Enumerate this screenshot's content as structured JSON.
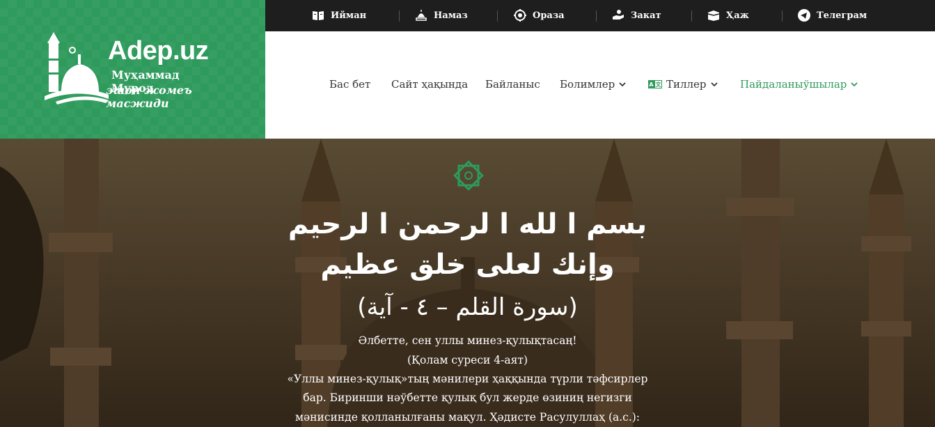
{
  "logo": {
    "title": "Adep.uz",
    "subtitle_line1": "Муҳаммад Мурод",
    "subtitle_line2": "эшон жомеъ масжиди",
    "bg_color": "#2e9a5c"
  },
  "topbar": {
    "items": [
      {
        "label": "Ийман",
        "icon": "quran-icon"
      },
      {
        "label": "Намаз",
        "icon": "prayer-icon"
      },
      {
        "label": "Ораза",
        "icon": "fasting-icon"
      },
      {
        "label": "Закат",
        "icon": "charity-hand-icon"
      },
      {
        "label": "Ҳаж",
        "icon": "kaaba-icon"
      },
      {
        "label": "Телеграм",
        "icon": "telegram-icon"
      }
    ]
  },
  "nav": {
    "items": [
      {
        "label": "Бас бет",
        "dropdown": false
      },
      {
        "label": "Сайт ҳақында",
        "dropdown": false
      },
      {
        "label": "Байланыс",
        "dropdown": false
      },
      {
        "label": "Болимлер",
        "dropdown": true
      },
      {
        "label": "Тиллер",
        "dropdown": true,
        "icon": "translate-icon"
      },
      {
        "label": "Пайдаланыўшылар",
        "dropdown": true,
        "active": true
      }
    ],
    "active_color": "#2e9a5c"
  },
  "hero": {
    "arabic_line1": "بسم ا لله ا لرحمن ا لرحيم",
    "arabic_line2": "وإنك لعلى خلق عظيم",
    "arabic_line3": "(سورة القلم – ٤ - آية)",
    "text_line1": "Әлбетте, сен уллы минез-қулықтасаң!",
    "text_line2": "(Қолам суреси 4-аят)",
    "text_line3": "«Уллы минез-қулық»тың мәнилери ҳаққында түрли тәфсирлер",
    "text_line4": "бар. Биринши нәўбетте қулық бул жерде өзиниң негизги",
    "text_line5": "мәнисинде қолланылғаны мақул. Ҳәдисте Расулуллаҳ (а.с.):"
  }
}
